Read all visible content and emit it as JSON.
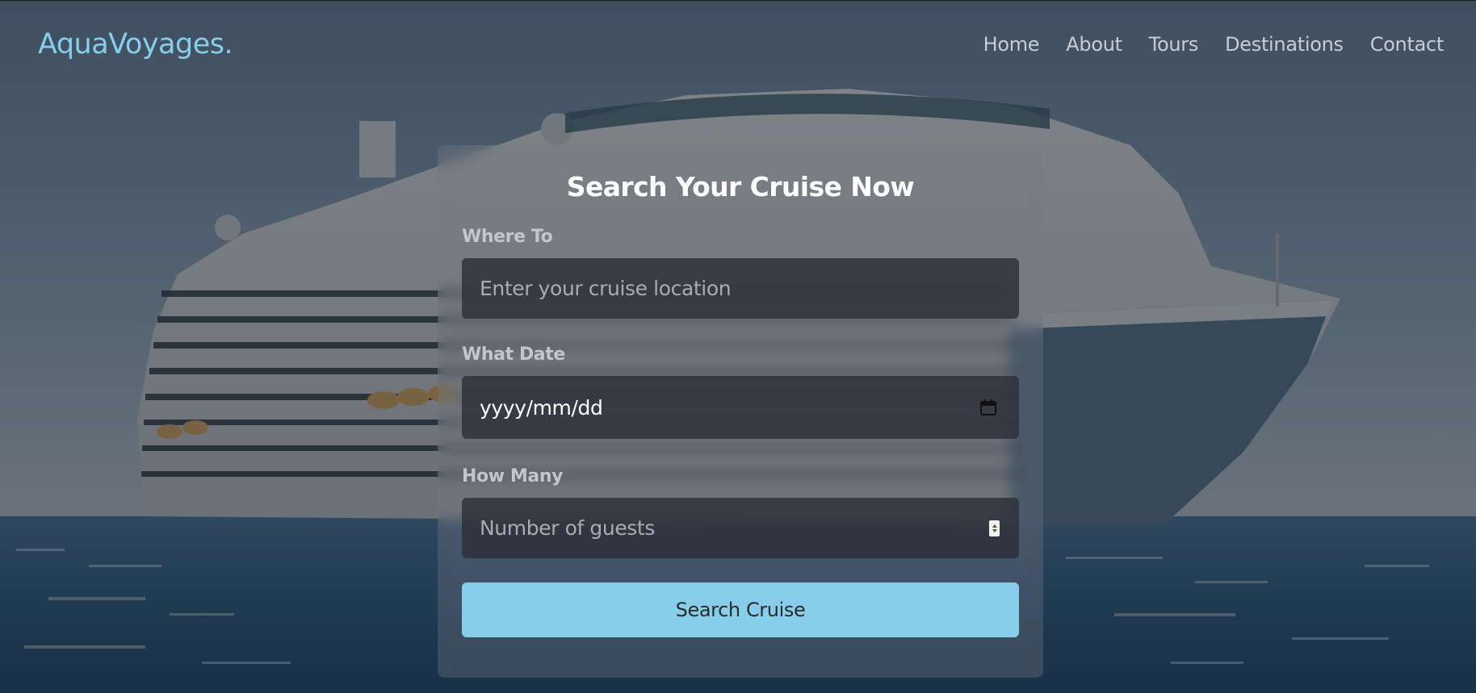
{
  "brand": {
    "logo": "AquaVoyages.",
    "accent_color": "#87ceeb"
  },
  "nav": {
    "items": [
      {
        "label": "Home"
      },
      {
        "label": "About"
      },
      {
        "label": "Tours"
      },
      {
        "label": "Destinations"
      },
      {
        "label": "Contact"
      }
    ]
  },
  "hero": {
    "background": "cruise-ship-on-sea-photo"
  },
  "search": {
    "title": "Search Your Cruise Now",
    "where": {
      "label": "Where To",
      "placeholder": "Enter your cruise location"
    },
    "date": {
      "label": "What Date",
      "value": "yyyy/mm/dd",
      "icon": "calendar-icon"
    },
    "guests": {
      "label": "How Many",
      "placeholder": "Number of guests",
      "icon": "spinner-icon"
    },
    "submit_label": "Search Cruise"
  }
}
